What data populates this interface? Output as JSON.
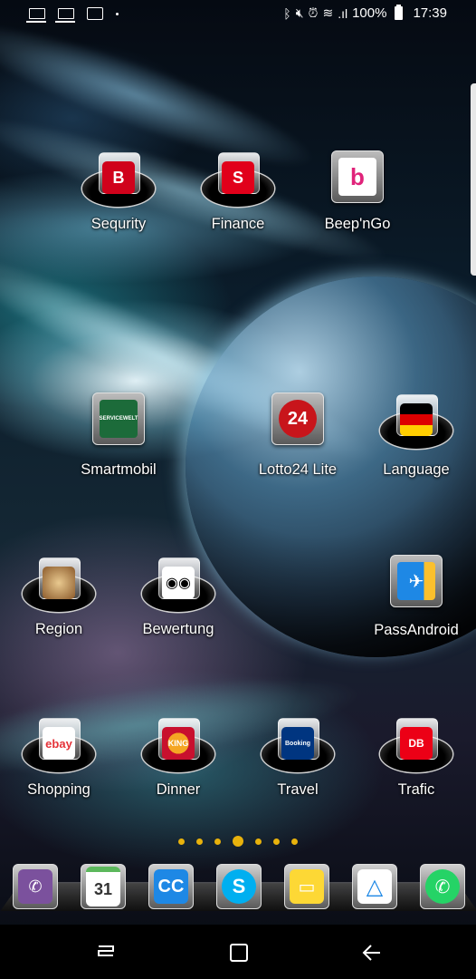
{
  "status_bar": {
    "battery": "100%",
    "time": "17:39",
    "left_icons": [
      "laptop-icon",
      "laptop-icon",
      "activity-icon",
      "dot-icon"
    ],
    "right_icons": [
      "bluetooth-icon",
      "mute-icon",
      "alarm-icon",
      "wifi-icon",
      "signal-icon",
      "battery-icon"
    ]
  },
  "apps": {
    "sequrity": "Sequrity",
    "finance": "Finance",
    "beepngo": "Beep'nGo",
    "smartmobil": "Smartmobil",
    "lotto": "Lotto24 Lite",
    "language": "Language",
    "region": "Region",
    "bewertung": "Bewertung",
    "passandroid": "PassAndroid",
    "shopping": "Shopping",
    "dinner": "Dinner",
    "travel": "Travel",
    "trafic": "Trafic"
  },
  "icon_text": {
    "sequrity_badge": "B",
    "finance_badge": "S",
    "beepngo_badge": "b",
    "smartmobil_badge": "SERVICEWELT",
    "lotto_badge": "24",
    "ebay_badge": "ebay",
    "bk_badge": "KING",
    "booking_badge": "Booking",
    "db_badge": "DB",
    "calendar_day": "31",
    "cc_badge": "CC"
  },
  "pager": {
    "count": 7,
    "active_index": 3
  },
  "dock": [
    "viber-icon",
    "calendar-icon",
    "cc-icon",
    "skype-icon",
    "messages-icon",
    "drive-icon",
    "whatsapp-icon"
  ],
  "colors": {
    "accent_dot": "#e8b20c",
    "badge_red": "#d0021b"
  }
}
